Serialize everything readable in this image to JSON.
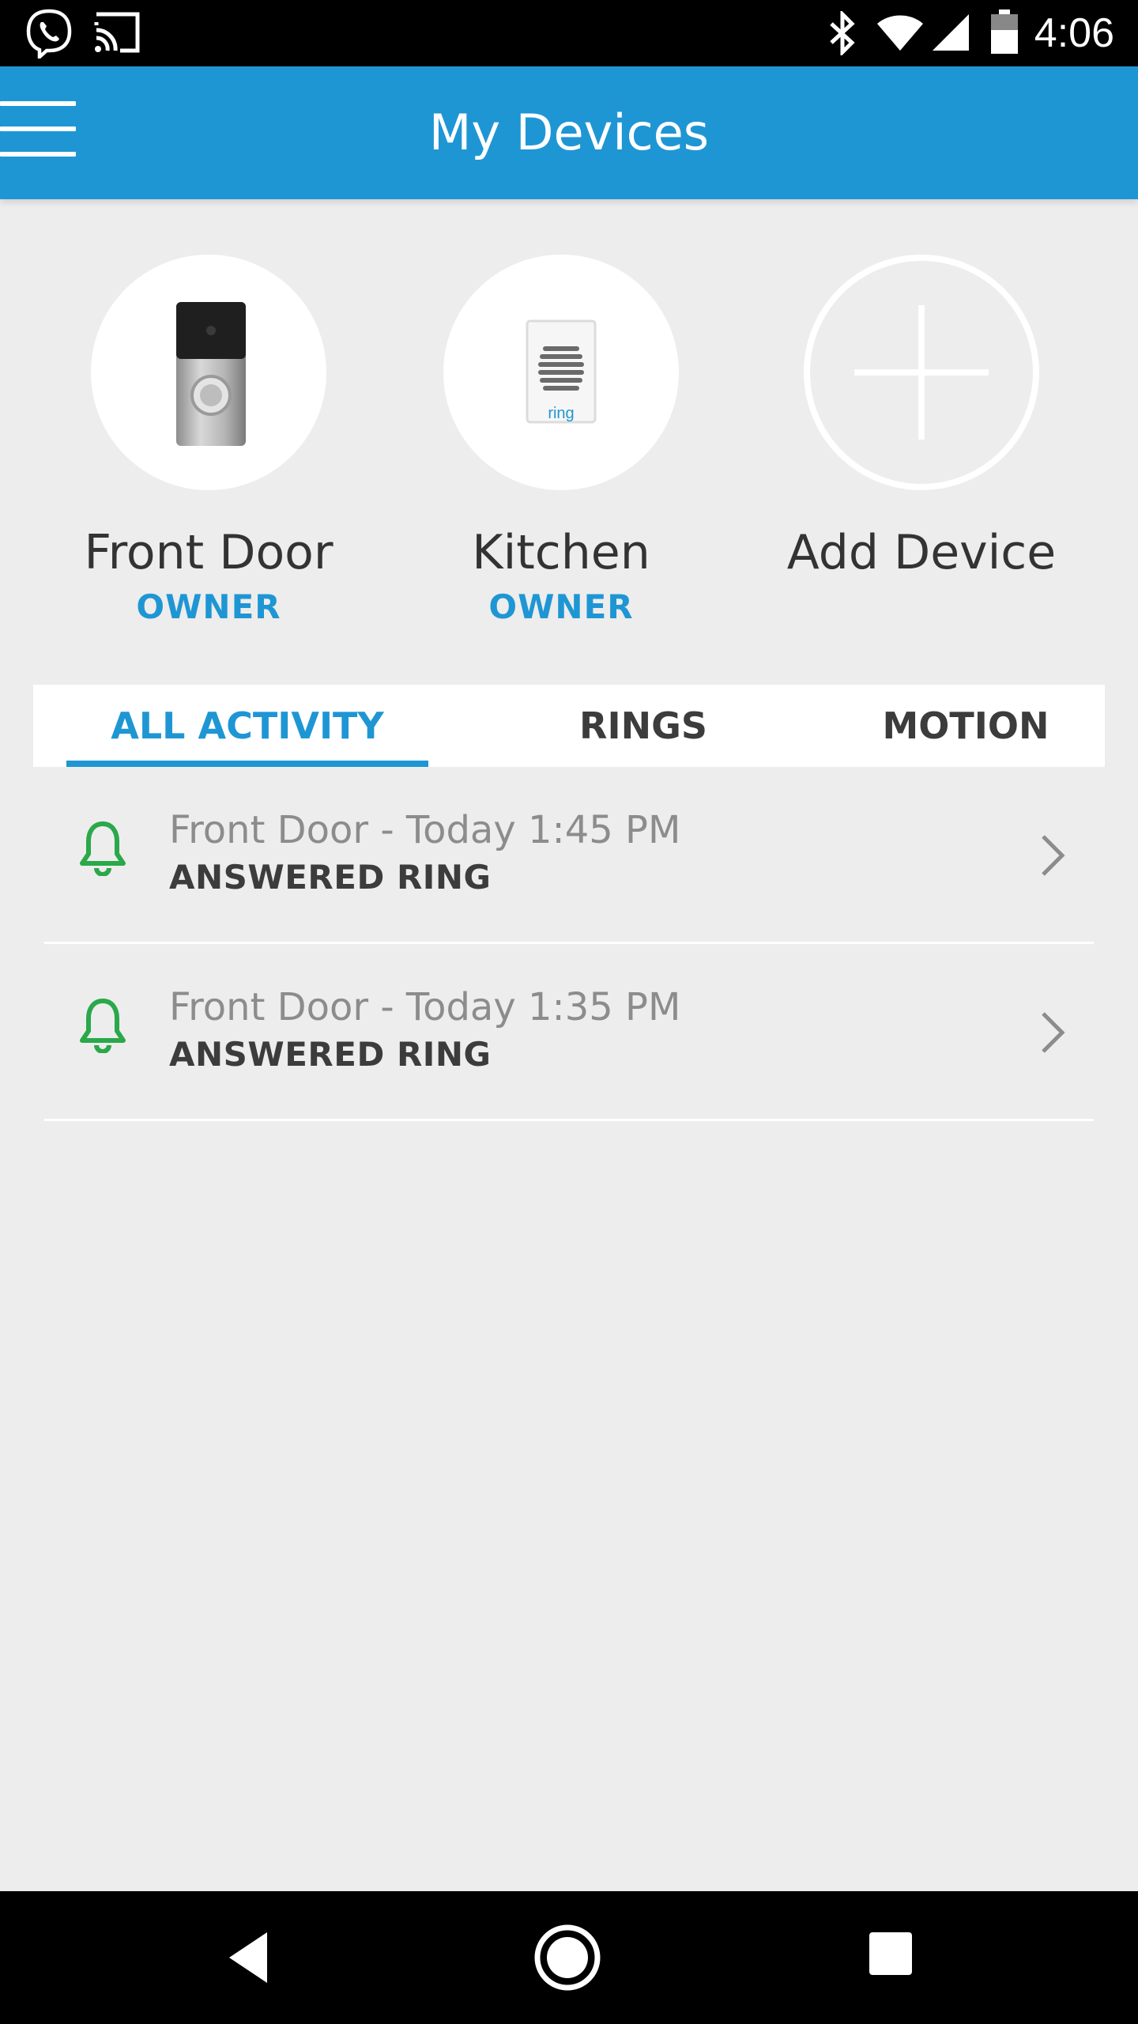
{
  "status_bar": {
    "time": "4:06",
    "icons": [
      "viber-icon",
      "cast-icon",
      "bluetooth-icon",
      "wifi-icon",
      "signal-icon",
      "battery-icon"
    ]
  },
  "app_bar": {
    "title": "My Devices",
    "background": "#1f96d4"
  },
  "devices": [
    {
      "name": "Front Door",
      "role": "OWNER",
      "icon": "doorbell-icon"
    },
    {
      "name": "Kitchen",
      "role": "OWNER",
      "icon": "chime-icon",
      "badge": "ring"
    },
    {
      "name": "Add Device",
      "icon": "plus-icon"
    }
  ],
  "tabs": [
    {
      "label": "ALL ACTIVITY",
      "active": true
    },
    {
      "label": "RINGS",
      "active": false
    },
    {
      "label": "MOTION",
      "active": false
    }
  ],
  "activity": [
    {
      "title": "Front Door - Today 1:45 PM",
      "status": "ANSWERED RING",
      "icon": "bell-icon",
      "icon_color": "#2aa84a"
    },
    {
      "title": "Front Door - Today 1:35 PM",
      "status": "ANSWERED RING",
      "icon": "bell-icon",
      "icon_color": "#2aa84a"
    }
  ],
  "colors": {
    "accent": "#1f96d4",
    "background": "#ededed",
    "answered": "#2aa84a"
  },
  "nav_bar": {
    "icons": [
      "back-icon",
      "home-icon",
      "recents-icon"
    ]
  }
}
